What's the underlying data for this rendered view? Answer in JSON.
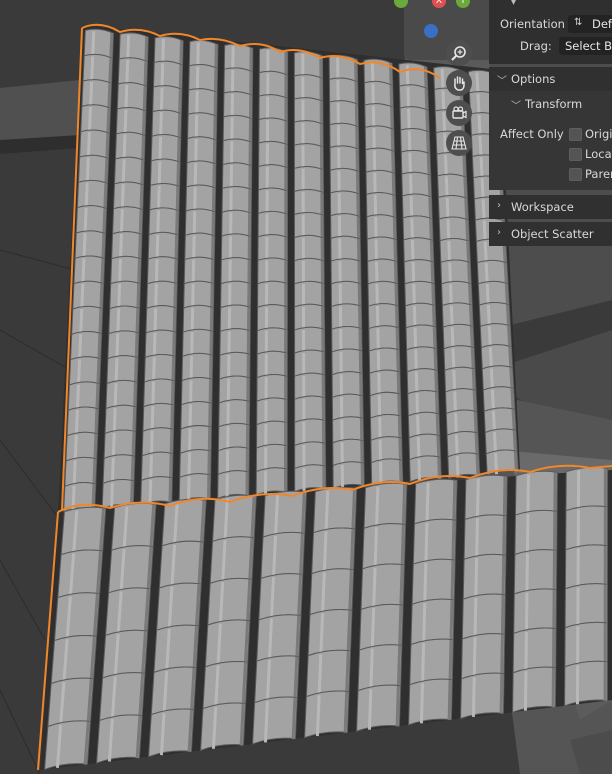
{
  "viewport": {
    "description_tag": "roof-tile-model",
    "nav_buttons": [
      "zoom-icon",
      "hand-pan-icon",
      "camera-view-icon",
      "perspective-grid-icon"
    ],
    "axis_labels": {
      "x": "X",
      "y": "Y",
      "z": ""
    }
  },
  "sidebar": {
    "orientation_label": "Orientation",
    "orientation_value": "Def",
    "drag_label": "Drag:",
    "drag_value": "Select Bo",
    "options_label": "Options",
    "transform_label": "Transform",
    "affect_only_label": "Affect Only",
    "affect_items": [
      {
        "label": "Origi",
        "checked": false
      },
      {
        "label": "Locat",
        "checked": false
      },
      {
        "label": "Parer",
        "checked": false
      }
    ],
    "workspace_label": "Workspace",
    "object_scatter_label": "Object Scatter"
  },
  "colors": {
    "selection_outline": "#f0872a",
    "tile": "#a3a3a3",
    "background": "#3a3a3a",
    "axis_x": "#e05050",
    "axis_y": "#6aaa3a",
    "axis_z": "#3a6fc4"
  }
}
